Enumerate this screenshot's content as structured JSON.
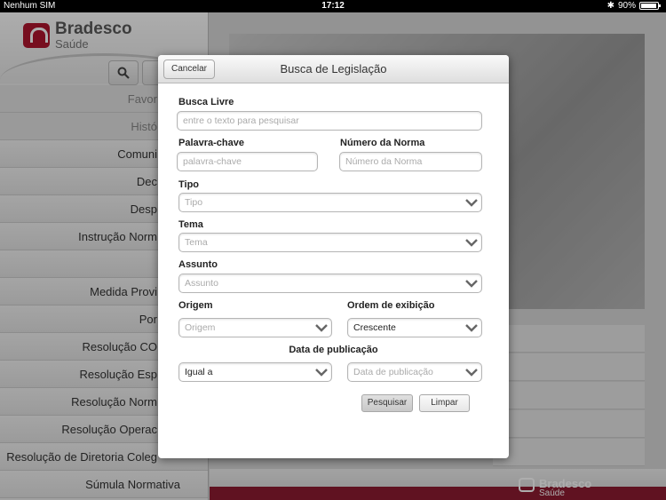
{
  "statusbar": {
    "carrier": "Nenhum SIM",
    "time": "17:12",
    "battery": "90%"
  },
  "left": {
    "brand": "Bradesco",
    "brand_sub": "Saúde",
    "items": [
      "Favor",
      "Histó",
      "Comuni",
      "Dec",
      "Desp",
      "Instrução Norm",
      "",
      "Medida Provi",
      "Por",
      "Resolução CO",
      "Resolução Esp",
      "Resolução Norm",
      "Resolução Operac",
      "Resolução de Diretoria Coleg",
      "Súmula Normativa"
    ]
  },
  "footer": {
    "brand": "Bradesco",
    "brand_sub": "Saúde"
  },
  "modal": {
    "title": "Busca de Legislação",
    "cancel": "Cancelar",
    "busca_livre": {
      "label": "Busca Livre",
      "placeholder": "entre o texto para pesquisar"
    },
    "palavra_chave": {
      "label": "Palavra-chave",
      "placeholder": "palavra-chave"
    },
    "numero_norma": {
      "label": "Número da Norma",
      "placeholder": "Número da Norma"
    },
    "tipo": {
      "label": "Tipo",
      "placeholder": "Tipo"
    },
    "tema": {
      "label": "Tema",
      "placeholder": "Tema"
    },
    "assunto": {
      "label": "Assunto",
      "placeholder": "Assunto"
    },
    "origem": {
      "label": "Origem",
      "placeholder": "Origem"
    },
    "ordem": {
      "label": "Ordem de exibição",
      "value": "Crescente"
    },
    "data_publicacao": {
      "label": "Data de publicação",
      "operator": "Igual a",
      "placeholder": "Data de publicação"
    },
    "pesquisar": "Pesquisar",
    "limpar": "Limpar"
  }
}
